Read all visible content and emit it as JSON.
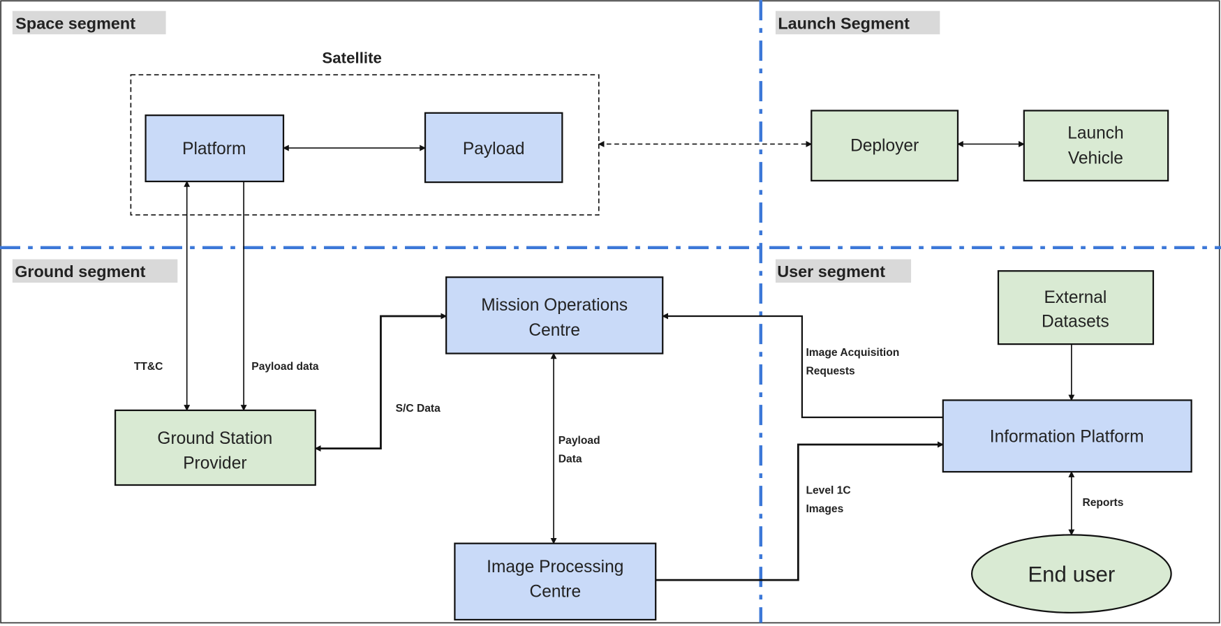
{
  "segments": {
    "space": "Space segment",
    "launch": "Launch Segment",
    "ground": "Ground segment",
    "user": "User segment"
  },
  "satellite_group": "Satellite",
  "nodes": {
    "platform": "Platform",
    "payload": "Payload",
    "deployer": "Deployer",
    "launch_vehicle": [
      "Launch",
      "Vehicle"
    ],
    "ground_station": [
      "Ground Station",
      "Provider"
    ],
    "mission_ops": [
      "Mission Operations",
      "Centre"
    ],
    "image_proc": [
      "Image Processing",
      "Centre"
    ],
    "external": [
      "External",
      "Datasets"
    ],
    "info_platform": "Information Platform",
    "end_user": "End user"
  },
  "edge_labels": {
    "ttc": "TT&C",
    "payload_data": "Payload data",
    "sc_data": "S/C Data",
    "payload_data_2": [
      "Payload",
      "Data"
    ],
    "image_requests": [
      "Image Acquisition",
      "Requests"
    ],
    "level1c": [
      "Level 1C",
      "Images"
    ],
    "reports": "Reports"
  },
  "colors": {
    "ground_and_launch_nodes": "#d9ead3",
    "space_and_processing_nodes": "#c9daf8",
    "segment_divider": "#3c78d8"
  }
}
